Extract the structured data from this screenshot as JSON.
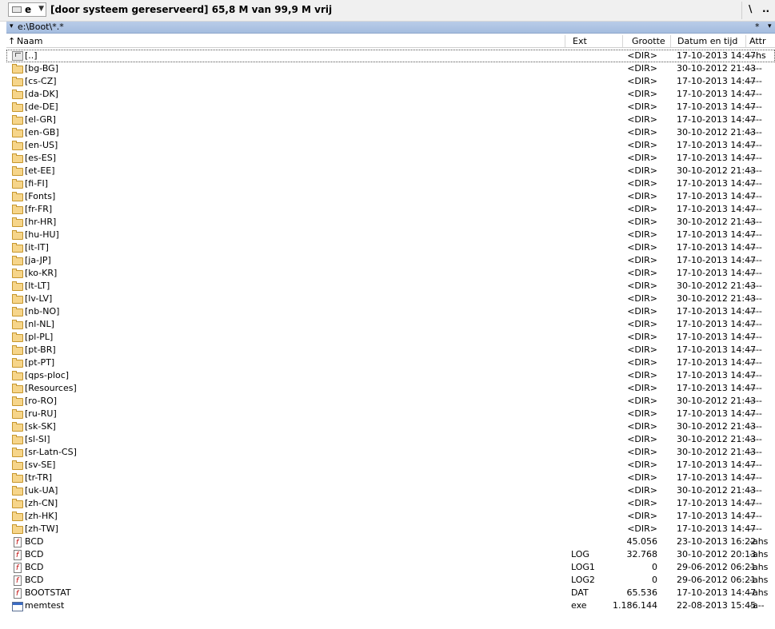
{
  "drive": {
    "letter": "e",
    "info": "[door systeem gereserveerd]  65,8 M van 99,9 M vrij",
    "root_button": "\\",
    "up_button": ".."
  },
  "path": {
    "arrow": "▾",
    "text": "e:\\Boot\\*.*",
    "star": "*",
    "dropdown": "▾"
  },
  "header": {
    "name": "Naam",
    "sort_indicator": "↑",
    "ext": "Ext",
    "size": "Grootte",
    "date": "Datum en tijd",
    "attr": "Attr"
  },
  "files": [
    {
      "icon": "up",
      "name": "[..]",
      "ext": "",
      "size": "<DIR>",
      "date": "17-10-2013 14:47",
      "attr": "--hs"
    },
    {
      "icon": "folder",
      "name": "[bg-BG]",
      "ext": "",
      "size": "<DIR>",
      "date": "30-10-2012 21:43",
      "attr": "----"
    },
    {
      "icon": "folder",
      "name": "[cs-CZ]",
      "ext": "",
      "size": "<DIR>",
      "date": "17-10-2013 14:47",
      "attr": "----"
    },
    {
      "icon": "folder",
      "name": "[da-DK]",
      "ext": "",
      "size": "<DIR>",
      "date": "17-10-2013 14:47",
      "attr": "----"
    },
    {
      "icon": "folder",
      "name": "[de-DE]",
      "ext": "",
      "size": "<DIR>",
      "date": "17-10-2013 14:47",
      "attr": "----"
    },
    {
      "icon": "folder",
      "name": "[el-GR]",
      "ext": "",
      "size": "<DIR>",
      "date": "17-10-2013 14:47",
      "attr": "----"
    },
    {
      "icon": "folder",
      "name": "[en-GB]",
      "ext": "",
      "size": "<DIR>",
      "date": "30-10-2012 21:43",
      "attr": "----"
    },
    {
      "icon": "folder",
      "name": "[en-US]",
      "ext": "",
      "size": "<DIR>",
      "date": "17-10-2013 14:47",
      "attr": "----"
    },
    {
      "icon": "folder",
      "name": "[es-ES]",
      "ext": "",
      "size": "<DIR>",
      "date": "17-10-2013 14:47",
      "attr": "----"
    },
    {
      "icon": "folder",
      "name": "[et-EE]",
      "ext": "",
      "size": "<DIR>",
      "date": "30-10-2012 21:43",
      "attr": "----"
    },
    {
      "icon": "folder",
      "name": "[fi-FI]",
      "ext": "",
      "size": "<DIR>",
      "date": "17-10-2013 14:47",
      "attr": "----"
    },
    {
      "icon": "folder",
      "name": "[Fonts]",
      "ext": "",
      "size": "<DIR>",
      "date": "17-10-2013 14:47",
      "attr": "----"
    },
    {
      "icon": "folder",
      "name": "[fr-FR]",
      "ext": "",
      "size": "<DIR>",
      "date": "17-10-2013 14:47",
      "attr": "----"
    },
    {
      "icon": "folder",
      "name": "[hr-HR]",
      "ext": "",
      "size": "<DIR>",
      "date": "30-10-2012 21:43",
      "attr": "----"
    },
    {
      "icon": "folder",
      "name": "[hu-HU]",
      "ext": "",
      "size": "<DIR>",
      "date": "17-10-2013 14:47",
      "attr": "----"
    },
    {
      "icon": "folder",
      "name": "[it-IT]",
      "ext": "",
      "size": "<DIR>",
      "date": "17-10-2013 14:47",
      "attr": "----"
    },
    {
      "icon": "folder",
      "name": "[ja-JP]",
      "ext": "",
      "size": "<DIR>",
      "date": "17-10-2013 14:47",
      "attr": "----"
    },
    {
      "icon": "folder",
      "name": "[ko-KR]",
      "ext": "",
      "size": "<DIR>",
      "date": "17-10-2013 14:47",
      "attr": "----"
    },
    {
      "icon": "folder",
      "name": "[lt-LT]",
      "ext": "",
      "size": "<DIR>",
      "date": "30-10-2012 21:43",
      "attr": "----"
    },
    {
      "icon": "folder",
      "name": "[lv-LV]",
      "ext": "",
      "size": "<DIR>",
      "date": "30-10-2012 21:43",
      "attr": "----"
    },
    {
      "icon": "folder",
      "name": "[nb-NO]",
      "ext": "",
      "size": "<DIR>",
      "date": "17-10-2013 14:47",
      "attr": "----"
    },
    {
      "icon": "folder",
      "name": "[nl-NL]",
      "ext": "",
      "size": "<DIR>",
      "date": "17-10-2013 14:47",
      "attr": "----"
    },
    {
      "icon": "folder",
      "name": "[pl-PL]",
      "ext": "",
      "size": "<DIR>",
      "date": "17-10-2013 14:47",
      "attr": "----"
    },
    {
      "icon": "folder",
      "name": "[pt-BR]",
      "ext": "",
      "size": "<DIR>",
      "date": "17-10-2013 14:47",
      "attr": "----"
    },
    {
      "icon": "folder",
      "name": "[pt-PT]",
      "ext": "",
      "size": "<DIR>",
      "date": "17-10-2013 14:47",
      "attr": "----"
    },
    {
      "icon": "folder",
      "name": "[qps-ploc]",
      "ext": "",
      "size": "<DIR>",
      "date": "17-10-2013 14:47",
      "attr": "----"
    },
    {
      "icon": "folder",
      "name": "[Resources]",
      "ext": "",
      "size": "<DIR>",
      "date": "17-10-2013 14:47",
      "attr": "----"
    },
    {
      "icon": "folder",
      "name": "[ro-RO]",
      "ext": "",
      "size": "<DIR>",
      "date": "30-10-2012 21:43",
      "attr": "----"
    },
    {
      "icon": "folder",
      "name": "[ru-RU]",
      "ext": "",
      "size": "<DIR>",
      "date": "17-10-2013 14:47",
      "attr": "----"
    },
    {
      "icon": "folder",
      "name": "[sk-SK]",
      "ext": "",
      "size": "<DIR>",
      "date": "30-10-2012 21:43",
      "attr": "----"
    },
    {
      "icon": "folder",
      "name": "[sl-SI]",
      "ext": "",
      "size": "<DIR>",
      "date": "30-10-2012 21:43",
      "attr": "----"
    },
    {
      "icon": "folder",
      "name": "[sr-Latn-CS]",
      "ext": "",
      "size": "<DIR>",
      "date": "30-10-2012 21:43",
      "attr": "----"
    },
    {
      "icon": "folder",
      "name": "[sv-SE]",
      "ext": "",
      "size": "<DIR>",
      "date": "17-10-2013 14:47",
      "attr": "----"
    },
    {
      "icon": "folder",
      "name": "[tr-TR]",
      "ext": "",
      "size": "<DIR>",
      "date": "17-10-2013 14:47",
      "attr": "----"
    },
    {
      "icon": "folder",
      "name": "[uk-UA]",
      "ext": "",
      "size": "<DIR>",
      "date": "30-10-2012 21:43",
      "attr": "----"
    },
    {
      "icon": "folder",
      "name": "[zh-CN]",
      "ext": "",
      "size": "<DIR>",
      "date": "17-10-2013 14:47",
      "attr": "----"
    },
    {
      "icon": "folder",
      "name": "[zh-HK]",
      "ext": "",
      "size": "<DIR>",
      "date": "17-10-2013 14:47",
      "attr": "----"
    },
    {
      "icon": "folder",
      "name": "[zh-TW]",
      "ext": "",
      "size": "<DIR>",
      "date": "17-10-2013 14:47",
      "attr": "----"
    },
    {
      "icon": "file",
      "name": "BCD",
      "ext": "",
      "size": "45.056",
      "date": "23-10-2013 16:22",
      "attr": "-ahs"
    },
    {
      "icon": "file",
      "name": "BCD",
      "ext": "LOG",
      "size": "32.768",
      "date": "30-10-2012 20:13",
      "attr": "-ahs"
    },
    {
      "icon": "file",
      "name": "BCD",
      "ext": "LOG1",
      "size": "0",
      "date": "29-06-2012 06:21",
      "attr": "-ahs"
    },
    {
      "icon": "file",
      "name": "BCD",
      "ext": "LOG2",
      "size": "0",
      "date": "29-06-2012 06:21",
      "attr": "-ahs"
    },
    {
      "icon": "file",
      "name": "BOOTSTAT",
      "ext": "DAT",
      "size": "65.536",
      "date": "17-10-2013 14:47",
      "attr": "-ahs"
    },
    {
      "icon": "exe",
      "name": "memtest",
      "ext": "exe",
      "size": "1.186.144",
      "date": "22-08-2013 15:45",
      "attr": "-a--"
    }
  ]
}
